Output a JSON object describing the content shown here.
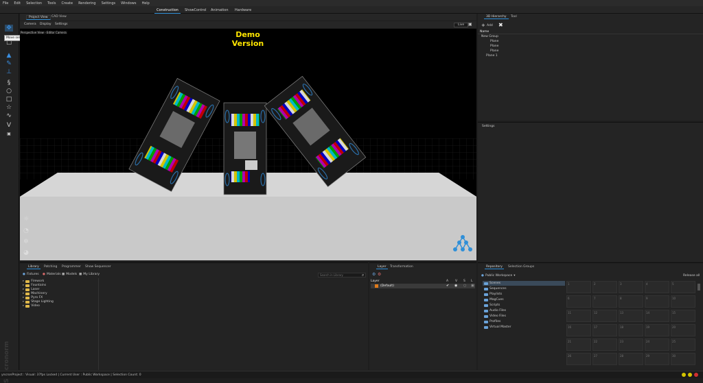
{
  "menu": [
    "File",
    "Edit",
    "Selection",
    "Tools",
    "Create",
    "Rendering",
    "Settings",
    "Windows",
    "Help"
  ],
  "modes": [
    "Construction",
    "ShowControl",
    "Animation",
    "Hardware"
  ],
  "active_mode": "Construction",
  "view_tabs": [
    "Project View",
    "CAD View"
  ],
  "view_sub": [
    "Camera",
    "Display",
    "Settings"
  ],
  "view_right": "Live",
  "tooltip": "Move selected Objects in all directions.",
  "viewport_label": "Perspective View - Editor Camera",
  "demo": "Demo Version",
  "hierarchy": {
    "tabs": [
      "3D Hierarchy",
      "Tool"
    ],
    "add_label": "Add",
    "name_header": "Name",
    "items": [
      {
        "label": "New Group",
        "indent": 0
      },
      {
        "label": "Plane",
        "indent": 1
      },
      {
        "label": "Plane",
        "indent": 1
      },
      {
        "label": "Plane",
        "indent": 1
      },
      {
        "label": "Plane 1",
        "indent": 0
      }
    ]
  },
  "settings_title": "Settings",
  "library": {
    "tabs": [
      "Library",
      "Patching",
      "Programmer",
      "Show Sequencer"
    ],
    "subtabs": [
      "Fixtures",
      "Materials",
      "Models",
      "My Library"
    ],
    "search_placeholder": "Search in Library",
    "folders": [
      "Firework",
      "Fountains",
      "Laser",
      "Machinery",
      "Pyro FX",
      "Stage Lighting",
      "Video"
    ]
  },
  "layer": {
    "tabs": [
      "Layer",
      "Transformation"
    ],
    "header": "Layer",
    "cols": [
      "A",
      "V",
      "S",
      "L"
    ],
    "row": "(Default)"
  },
  "repository": {
    "tabs": [
      "Repository",
      "Selection Groups"
    ],
    "workspace": "Public Workspace",
    "release": "Release all",
    "items": [
      "Scenes",
      "Sequences",
      "Playlists",
      "MagCues",
      "Scripts",
      "Audio Files",
      "Video Files",
      "Profiles",
      "Virtual Master"
    ],
    "grid": [
      "1",
      "2",
      "3",
      "4",
      "5",
      "6",
      "7",
      "8",
      "9",
      "10",
      "11",
      "12",
      "13",
      "14",
      "15",
      "16",
      "17",
      "18",
      "19",
      "20",
      "21",
      "22",
      "23",
      "24",
      "25",
      "26",
      "27",
      "28",
      "29",
      "30"
    ]
  },
  "status": "yncronProject : Visual: 37fps Locked | Current User : Public Workspace | Selection Count: 0",
  "watermark": "Syncronorm",
  "colors": {
    "accent": "#2f8fd8",
    "demo": "#ffe600",
    "folder": "#e0b84a"
  }
}
